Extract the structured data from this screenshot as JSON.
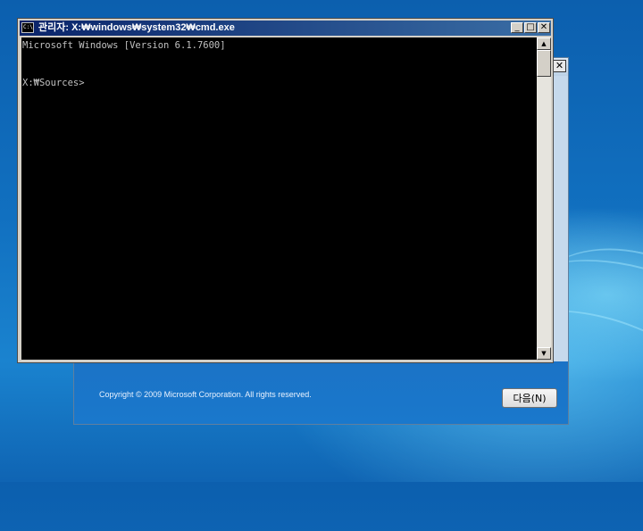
{
  "cmd_window": {
    "title": "관리자: X:₩windows₩system32₩cmd.exe",
    "icon": "cmd-app-icon",
    "icon_text": "C:\\",
    "minimize_glyph": "_",
    "maximize_glyph": "□",
    "close_glyph": "✕",
    "console_lines": [
      "Microsoft Windows [Version 6.1.7600]",
      "",
      "",
      "X:₩Sources>"
    ]
  },
  "setup_window": {
    "close_glyph": "✕",
    "copyright": "Copyright © 2009 Microsoft Corporation. All rights reserved.",
    "next_button_label": "다음(N)"
  },
  "scrollbar": {
    "up_glyph": "▲",
    "down_glyph": "▼"
  }
}
